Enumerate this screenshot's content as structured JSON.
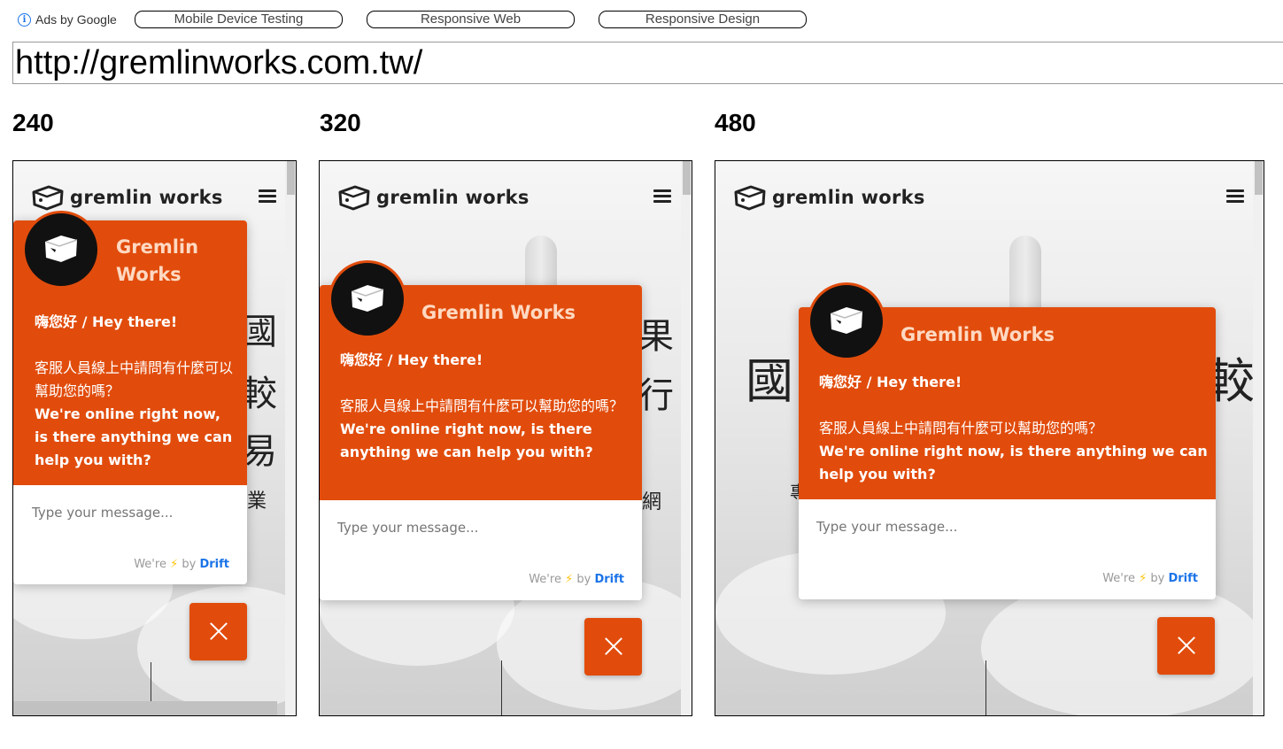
{
  "ads": {
    "label": "Ads by Google",
    "links": [
      "Mobile Device Testing",
      "Responsive Web",
      "Responsive Design"
    ]
  },
  "url_value": "http://gremlinworks.com.tw/",
  "sizes": [
    "240",
    "320",
    "480"
  ],
  "site": {
    "logo_text": "gremlin works"
  },
  "chat": {
    "bot_name": "Gremlin Works",
    "greeting": "嗨您好 / Hey there!",
    "question_zh": "客服人員線上中請問有什麼可以幫助您的嗎？",
    "question_en": "We're online right now, is there anything we can help you with?",
    "input_placeholder": "Type your message...",
    "footer_were": "We're",
    "footer_bolt": "⚡",
    "footer_by": "by",
    "footer_drift": "Drift"
  },
  "background_text": {
    "f240_lines": [
      "國",
      "較",
      "易",
      "業"
    ],
    "f320_lines": [
      "果",
      "行",
      "網"
    ],
    "f480_lines": [
      "國",
      "較",
      "專"
    ]
  },
  "colors": {
    "accent": "#e14c0c",
    "drift_blue": "#1a73e8"
  }
}
